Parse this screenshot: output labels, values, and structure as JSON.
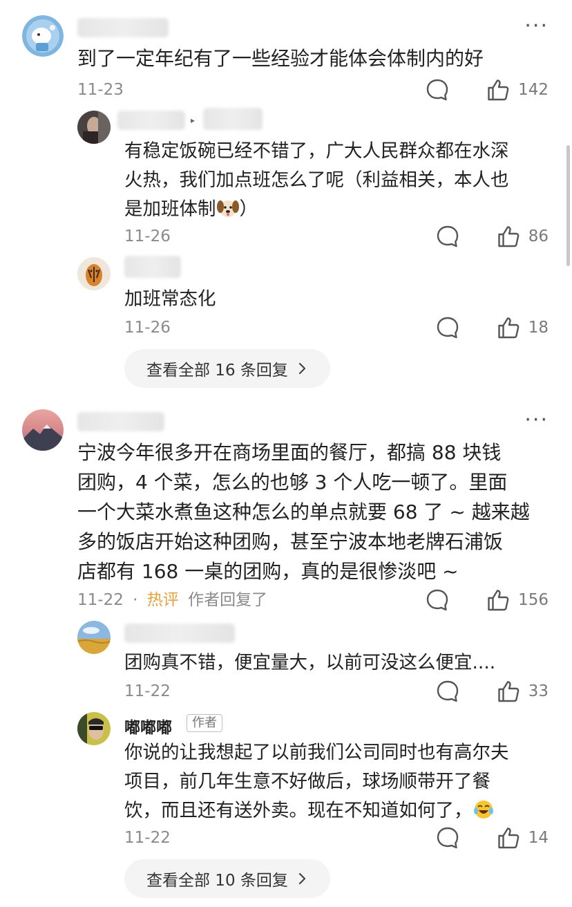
{
  "comments": [
    {
      "text": "到了一定年纪有了一些经验才能体会体制内的好",
      "date": "11-23",
      "likes": "142",
      "replies": [
        {
          "lines": [
            "有稳定饭碗已经不错了，广大人民群众都在水深",
            "火热，我们加点班怎么了呢（利益相关，本人也",
            "是加班体制"
          ],
          "line3_tail": "）",
          "date": "11-26",
          "likes": "86"
        },
        {
          "lines": [
            "加班常态化"
          ],
          "date": "11-26",
          "likes": "18"
        }
      ],
      "view_all": "查看全部 16 条回复"
    },
    {
      "lines": [
        "宁波今年很多开在商场里面的餐厅，都搞 88 块钱",
        "团购，4 个菜，怎么的也够 3 个人吃一顿了。里面",
        "一个大菜水煮鱼这种怎么的单点就要 68 了 ~ 越来越",
        "多的饭店开始这种团购，甚至宁波本地老牌石浦饭",
        "店都有 168 一桌的团购，真的是很惨淡吧 ~"
      ],
      "date": "11-22",
      "dot": "·",
      "hot_label": "热评",
      "author_replied": "作者回复了",
      "likes": "156",
      "replies": [
        {
          "lines": [
            "团购真不错，便宜量大，以前可没这么便宜...."
          ],
          "date": "11-22",
          "likes": "33"
        },
        {
          "name": "嘟嘟嘟",
          "tag": "作者",
          "lines": [
            "你说的让我想起了以前我们公司同时也有高尔夫",
            "项目，前几年生意不好做后，球场顺带开了餐",
            "饮，而且还有送外卖。现在不知道如何了，"
          ],
          "date": "11-22",
          "likes": "14"
        }
      ],
      "view_all": "查看全部 10 条回复"
    }
  ],
  "more_label": "···",
  "reply_arrow": "▸",
  "icons": {
    "comment": "comment-bubble-icon",
    "like": "thumbs-up-icon",
    "chevron": "chevron-right-icon",
    "dog": "dog-face-emoji",
    "laugh_cry": "laugh-cry-emoji"
  },
  "colors": {
    "hot": "#e6a23c",
    "meta": "#8a8a8a",
    "pill": "#f4f4f4"
  }
}
